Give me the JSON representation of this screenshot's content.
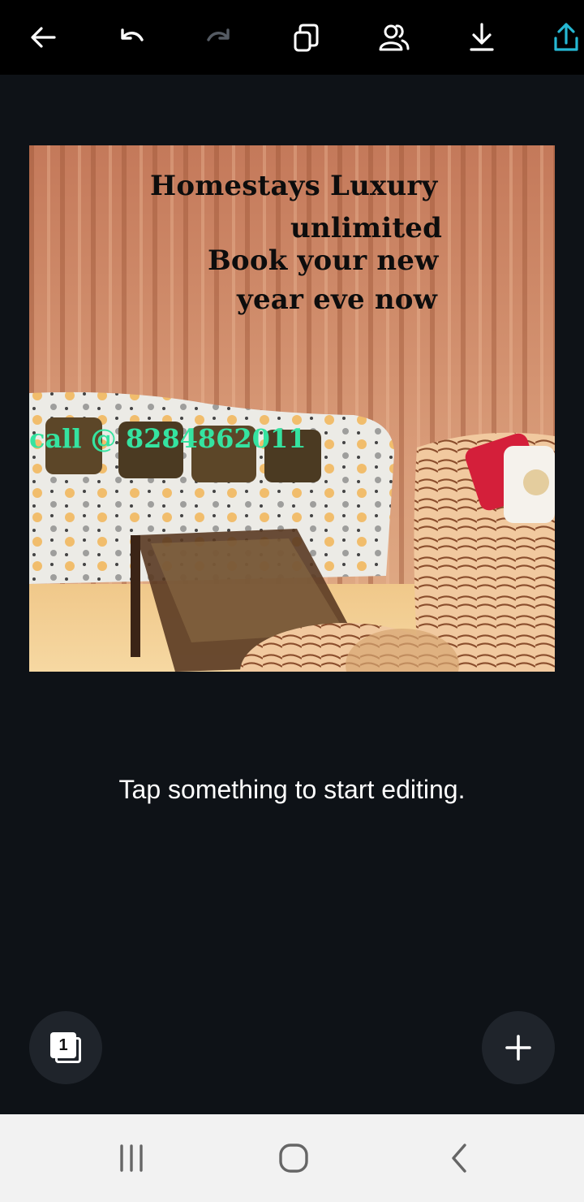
{
  "toolbar": {
    "icons": [
      "back-arrow-icon",
      "undo-icon",
      "redo-icon",
      "pages-icon",
      "share-people-icon",
      "download-icon",
      "share-export-icon"
    ],
    "accent": "#26b8d3"
  },
  "design": {
    "line1": "Homestays Luxury",
    "line2": "unlimited",
    "line3": "Book your new",
    "line4": "year eve now",
    "call_text": "call @ 8284862011",
    "call_color": "#35e3a0",
    "text_color": "#0d0d0d"
  },
  "hint": "Tap something to start editing.",
  "pages": {
    "count": "1"
  },
  "add_button_icon": "plus-icon",
  "navbar": {
    "icons": [
      "recent-apps-icon",
      "home-icon",
      "back-icon"
    ]
  }
}
